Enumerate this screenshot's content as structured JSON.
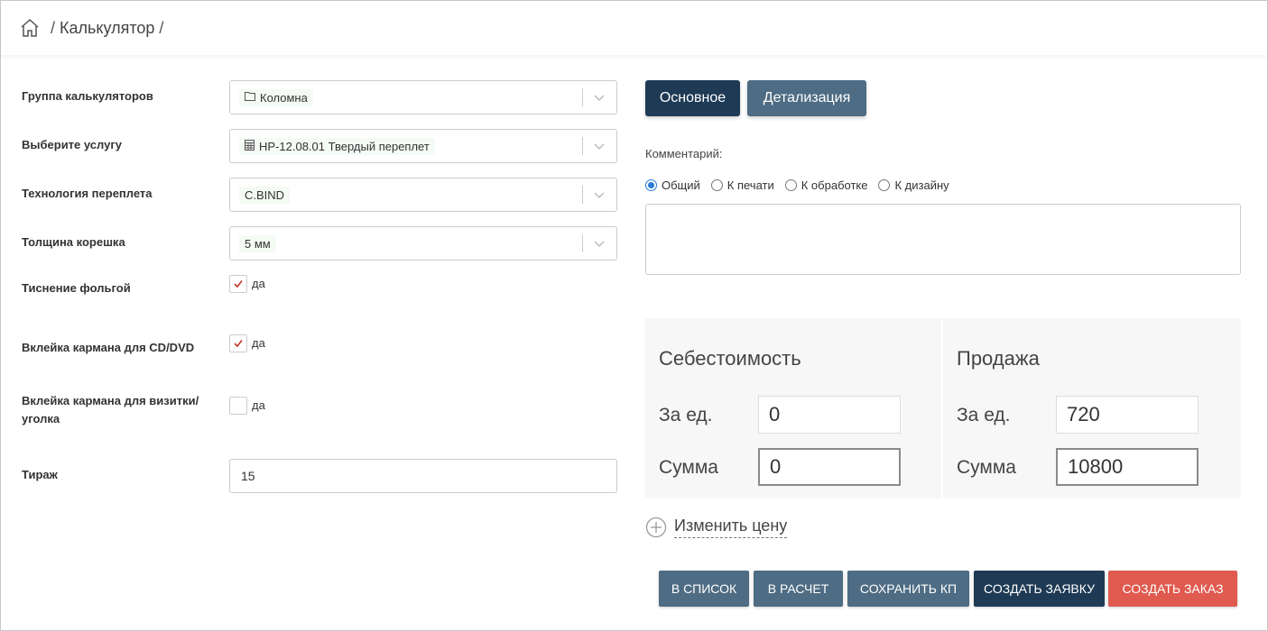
{
  "colors": {
    "primary_dark": "#1e3a55",
    "slate": "#4e6c83",
    "danger": "#e05a4f",
    "check_red": "#c0392b",
    "radio_blue": "#2a7ad8"
  },
  "breadcrumb": {
    "home_icon": "home-icon",
    "separator": "/",
    "current": "Калькулятор"
  },
  "form": {
    "calculator_group": {
      "label": "Группа калькуляторов",
      "value": "Коломна",
      "icon": "folder-icon"
    },
    "service": {
      "label": "Выберите услугу",
      "value": "HP-12.08.01 Твердый переплет",
      "icon": "calculator-icon"
    },
    "binding_tech": {
      "label": "Технология переплета",
      "value": "C.BIND"
    },
    "spine_thickness": {
      "label": "Толщина корешка",
      "value": "5 мм"
    },
    "foil_stamping": {
      "label": "Тиснение фольгой",
      "checkbox_label": "да",
      "checked": true
    },
    "cd_pocket": {
      "label": "Вклейка кармана для CD/DVD",
      "checkbox_label": "да",
      "checked": true
    },
    "card_pocket": {
      "label_line1": "Вклейка кармана для визитки/",
      "label_line2": "уголка",
      "checkbox_label": "да",
      "checked": false
    },
    "circulation": {
      "label": "Тираж",
      "value": "15"
    }
  },
  "tabs": {
    "main": "Основное",
    "details": "Детализация"
  },
  "comment": {
    "label": "Комментарий:",
    "options": [
      "Общий",
      "К печати",
      "К обработке",
      "К дизайну"
    ],
    "selected": "Общий",
    "value": ""
  },
  "pricing": {
    "cost": {
      "title": "Себестоимость",
      "per_unit_label": "За ед.",
      "per_unit": "0",
      "total_label": "Сумма",
      "total": "0"
    },
    "sale": {
      "title": "Продажа",
      "per_unit_label": "За ед.",
      "per_unit": "720",
      "total_label": "Сумма",
      "total": "10800"
    }
  },
  "change_price": "Изменить цену",
  "actions": {
    "to_list": "В СПИСОК",
    "to_calc": "В РАСЧЕТ",
    "save_kp": "СОХРАНИТЬ КП",
    "create_request": "СОЗДАТЬ ЗАЯВКУ",
    "create_order": "СОЗДАТЬ ЗАКАЗ"
  }
}
